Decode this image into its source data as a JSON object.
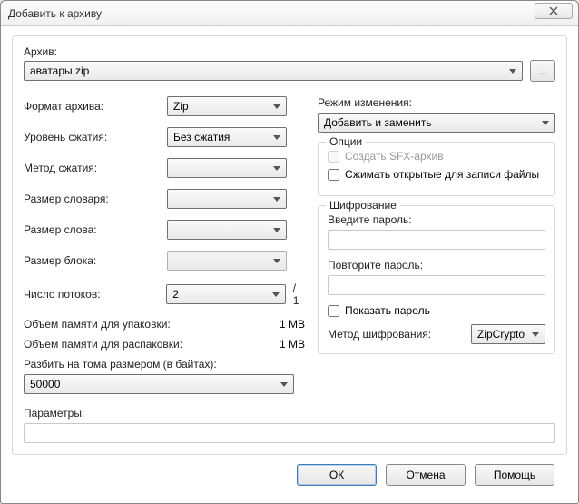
{
  "window": {
    "title": "Добавить к архиву"
  },
  "archive": {
    "label": "Архив:",
    "value": "аватары.zip",
    "browse_text": "..."
  },
  "left": {
    "format": {
      "label": "Формат архива:",
      "value": "Zip"
    },
    "level": {
      "label": "Уровень сжатия:",
      "value": "Без сжатия"
    },
    "method": {
      "label": "Метод сжатия:",
      "value": ""
    },
    "dict": {
      "label": "Размер словаря:",
      "value": ""
    },
    "word": {
      "label": "Размер слова:",
      "value": ""
    },
    "block": {
      "label": "Размер блока:",
      "value": ""
    },
    "threads": {
      "label": "Число потоков:",
      "value": "2",
      "suffix": "/ 1"
    },
    "mem_pack": {
      "label": "Объем памяти для упаковки:",
      "value": "1 MB"
    },
    "mem_unpack": {
      "label": "Объем памяти для распаковки:",
      "value": "1 MB"
    },
    "split_label": "Разбить на тома размером (в байтах):",
    "split_value": "50000"
  },
  "right": {
    "mode": {
      "label": "Режим изменения:",
      "value": "Добавить и заменить"
    },
    "options_title": "Опции",
    "opt_sfx": "Создать SFX-архив",
    "opt_shared": "Сжимать открытые для записи файлы",
    "encryption_title": "Шифрование",
    "pw_label": "Введите пароль:",
    "pw2_label": "Повторите пароль:",
    "show_pw": "Показать пароль",
    "enc_method_label": "Метод шифрования:",
    "enc_method_value": "ZipCrypto"
  },
  "params": {
    "label": "Параметры:",
    "value": ""
  },
  "buttons": {
    "ok": "ОК",
    "cancel": "Отмена",
    "help": "Помощь"
  }
}
